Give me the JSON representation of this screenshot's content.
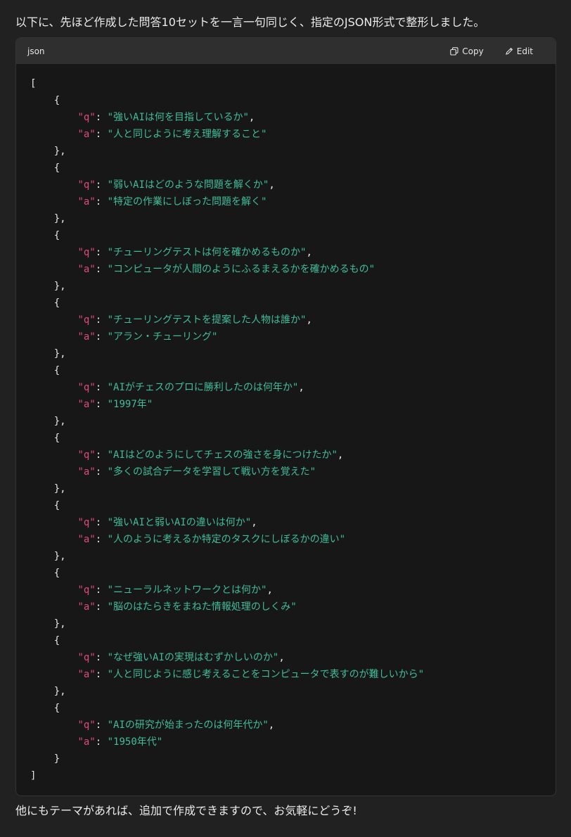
{
  "message": {
    "intro": "以下に、先ほど作成した問答10セットを一言一句同じく、指定のJSON形式で整形しました。",
    "outro": "他にもテーマがあれば、追加で作成できますので、お気軽にどうぞ!"
  },
  "code_block": {
    "language": "json",
    "copy_label": "Copy",
    "edit_label": "Edit",
    "open_bracket": "[",
    "close_bracket": "]",
    "open_brace": "{",
    "close_brace": "}",
    "close_brace_comma": "},",
    "key_q": "\"q\"",
    "key_a": "\"a\"",
    "items": [
      {
        "q": "強いAIは何を目指しているか",
        "a": "人と同じように考え理解すること"
      },
      {
        "q": "弱いAIはどのような問題を解くか",
        "a": "特定の作業にしぼった問題を解く"
      },
      {
        "q": "チューリングテストは何を確かめるものか",
        "a": "コンピュータが人間のようにふるまえるかを確かめるもの"
      },
      {
        "q": "チューリングテストを提案した人物は誰か",
        "a": "アラン・チューリング"
      },
      {
        "q": "AIがチェスのプロに勝利したのは何年か",
        "a": "1997年"
      },
      {
        "q": "AIはどのようにしてチェスの強さを身につけたか",
        "a": "多くの試合データを学習して戦い方を覚えた"
      },
      {
        "q": "強いAIと弱いAIの違いは何か",
        "a": "人のように考えるか特定のタスクにしぼるかの違い"
      },
      {
        "q": "ニューラルネットワークとは何か",
        "a": "脳のはたらきをまねた情報処理のしくみ"
      },
      {
        "q": "なぜ強いAIの実現はむずかしいのか",
        "a": "人と同じように感じ考えることをコンピュータで表すのが難しいから"
      },
      {
        "q": "AIの研究が始まったのは何年代か",
        "a": "1950年代"
      }
    ]
  },
  "icons": {
    "copy": "copy-icon",
    "edit": "edit-icon"
  },
  "colors": {
    "background": "#212121",
    "code_bg": "#171717",
    "header_bg": "#2f2f2f",
    "key": "#e0487c",
    "string": "#3fbd9b"
  }
}
